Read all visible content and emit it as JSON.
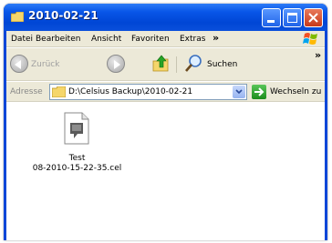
{
  "window": {
    "title": "2010-02-21"
  },
  "menu": [
    "Datei",
    "Bearbeiten",
    "Ansicht",
    "Favoriten",
    "Extras"
  ],
  "menu_overflow": "»",
  "toolbar": {
    "back_label": "Zurück",
    "search_label": "Suchen",
    "overflow": "»"
  },
  "address": {
    "label": "Adresse",
    "value": "D:\\Celsius Backup\\2010-02-21",
    "go_label": "Wechseln zu"
  },
  "file": {
    "name_line1": "Test",
    "name_line2": "08-2010-15-22-35.cel"
  }
}
